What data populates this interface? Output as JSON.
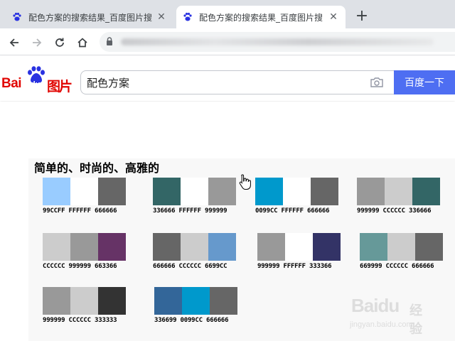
{
  "browser": {
    "tabs": [
      {
        "title": "配色方案的搜索结果_百度图片搜",
        "active": false,
        "favicon": "baidu-paw-icon"
      },
      {
        "title": "配色方案的搜索结果_百度图片搜",
        "active": true,
        "favicon": "baidu-paw-icon"
      }
    ],
    "new_tab_label": "+",
    "close_glyph": "✕"
  },
  "site": {
    "logo_bai": "Bai",
    "logo_du": "du",
    "logo_tupian": "图片",
    "search_value": "配色方案",
    "search_button": "百度一下"
  },
  "image": {
    "heading": "简单的、时尚的、高雅的",
    "palettes": [
      {
        "codes": "99CCFF FFFFFF 666666",
        "colors": [
          "#99CCFF",
          "#FFFFFF",
          "#666666"
        ]
      },
      {
        "codes": "336666 FFFFFF 999999",
        "colors": [
          "#336666",
          "#FFFFFF",
          "#999999"
        ]
      },
      {
        "codes": "0099CC FFFFFF 666666",
        "colors": [
          "#0099CC",
          "#FFFFFF",
          "#666666"
        ]
      },
      {
        "codes": "999999 CCCCCC 336666",
        "colors": [
          "#999999",
          "#CCCCCC",
          "#336666"
        ]
      },
      {
        "codes": "CCCCCC 999999 663366",
        "colors": [
          "#CCCCCC",
          "#999999",
          "#663366"
        ]
      },
      {
        "codes": "666666 CCCCCC 6699CC",
        "colors": [
          "#666666",
          "#CCCCCC",
          "#6699CC"
        ]
      },
      {
        "codes": "999999 FFFFFF 333366",
        "colors": [
          "#999999",
          "#FFFFFF",
          "#333366"
        ]
      },
      {
        "codes": "669999 CCCCCC 666666",
        "colors": [
          "#669999",
          "#CCCCCC",
          "#666666"
        ]
      },
      {
        "codes": "999999 CCCCCC 333333",
        "colors": [
          "#999999",
          "#CCCCCC",
          "#333333"
        ]
      },
      {
        "codes": "336699 0099CC 666666",
        "colors": [
          "#336699",
          "#0099CC",
          "#666666"
        ]
      }
    ]
  },
  "watermark": {
    "brand": "Baidu",
    "suffix": "经验",
    "url": "jingyan.baidu.com"
  },
  "colors": {
    "baidu_red": "#e10602",
    "search_blue": "#4e6ef2",
    "tab_strip": "#dee1e6"
  }
}
